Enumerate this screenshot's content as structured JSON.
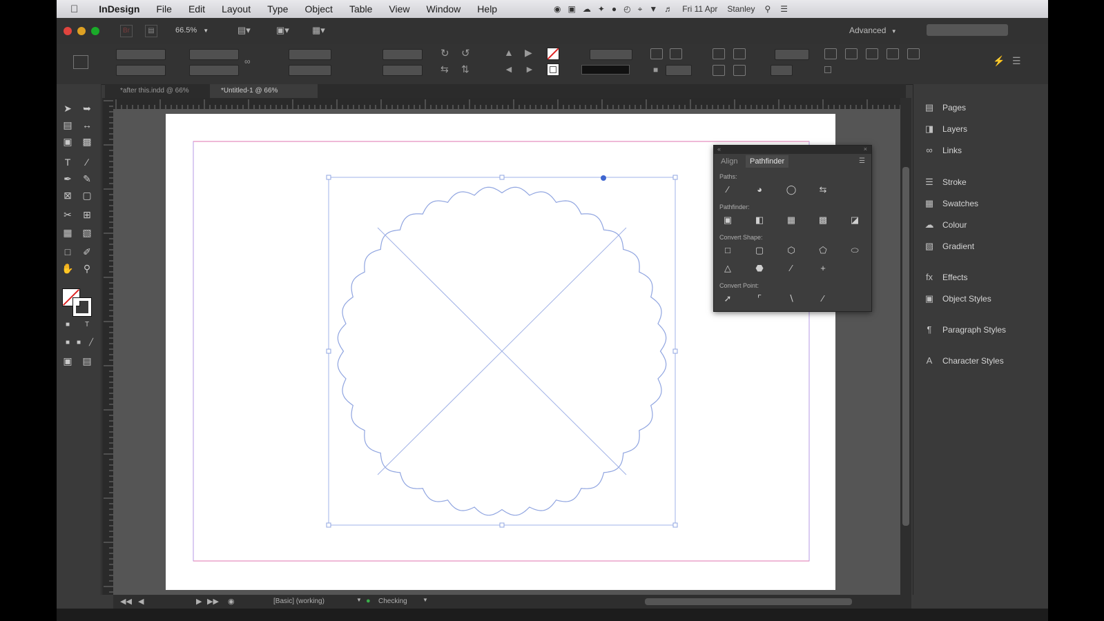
{
  "menubar": {
    "apple": "",
    "app_name": "InDesign",
    "items": [
      "File",
      "Edit",
      "Layout",
      "Type",
      "Object",
      "Table",
      "View",
      "Window",
      "Help"
    ],
    "clock": "Fri 11 Apr",
    "user": "Stanley"
  },
  "appbar": {
    "zoom": "66.5%",
    "workspace": "Advanced"
  },
  "document_tabs": [
    {
      "label": "*after this.indd @ 66%",
      "active": false
    },
    {
      "label": "*Untitled-1 @ 66%",
      "active": true
    }
  ],
  "pathfinder": {
    "tabs": [
      "Align",
      "Pathfinder"
    ],
    "active_tab": "Pathfinder",
    "sections": [
      "Paths:",
      "Pathfinder:",
      "Convert Shape:",
      "Convert Point:"
    ]
  },
  "dock": {
    "items": [
      "Pages",
      "Layers",
      "Links",
      "Stroke",
      "Swatches",
      "Colour",
      "Gradient",
      "Effects",
      "Object Styles",
      "Paragraph Styles",
      "Character Styles"
    ]
  },
  "statusbar": {
    "preflight": "[Basic] (working)",
    "errors": "Checking"
  },
  "colors": {
    "selection": "#6f8fe0",
    "margin_guide": "#e58fbf",
    "column_guide": "#b69ae6"
  }
}
